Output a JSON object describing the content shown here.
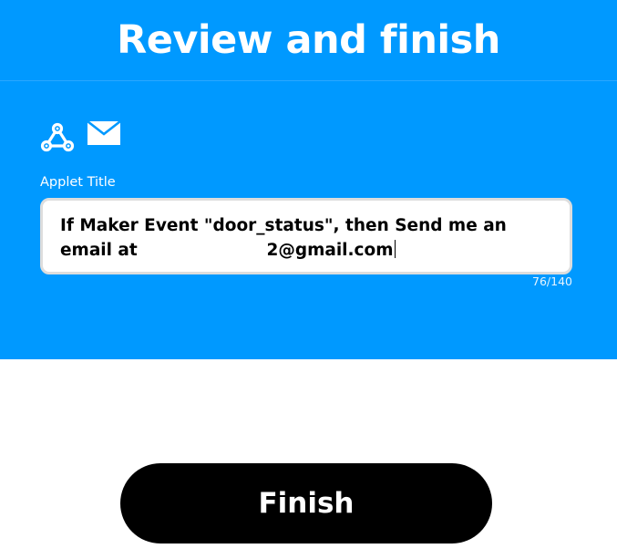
{
  "header": {
    "title": "Review and finish"
  },
  "services": [
    {
      "icon": "webhooks-icon"
    },
    {
      "icon": "email-icon"
    }
  ],
  "applet_title": {
    "label": "Applet Title",
    "value": "If Maker Event \"door_status\", then Send me an\nemail at                      2@gmail.com",
    "char_count": "76/140"
  },
  "actions": {
    "finish_label": "Finish"
  },
  "colors": {
    "panel": "#0099ff",
    "button": "#000000"
  }
}
